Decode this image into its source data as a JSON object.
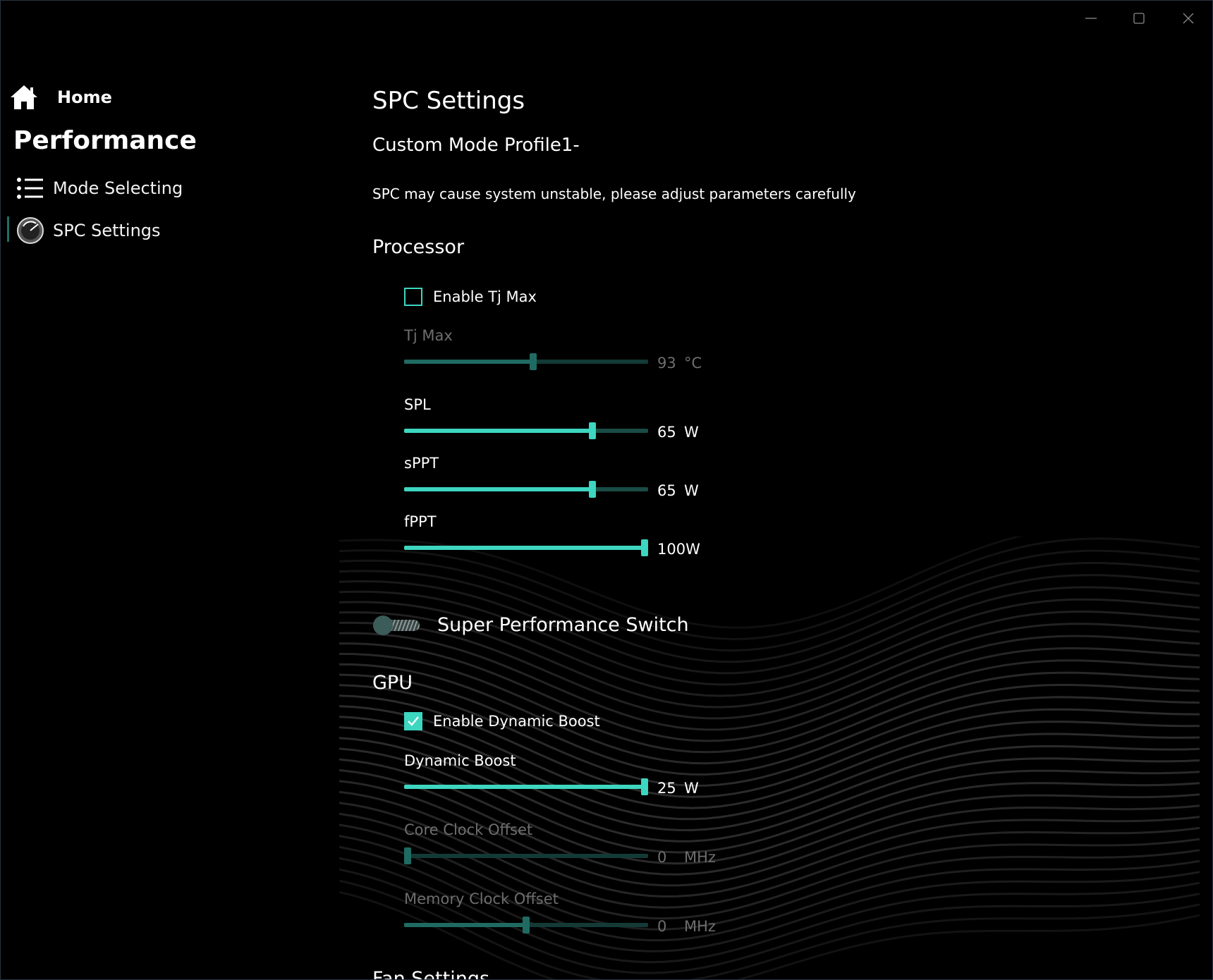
{
  "window": {
    "controls": [
      "minimize",
      "maximize",
      "close"
    ]
  },
  "sidebar": {
    "home_label": "Home",
    "section_title": "Performance",
    "items": [
      {
        "label": "Mode Selecting",
        "icon": "list-icon"
      },
      {
        "label": "SPC Settings",
        "icon": "gauge-icon",
        "selected": true
      }
    ]
  },
  "main": {
    "title": "SPC Settings",
    "profile": "Custom Mode Profile1-",
    "warning": "SPC may cause system unstable, please adjust parameters carefully",
    "processor": {
      "heading": "Processor",
      "enable_tjmax": {
        "label": "Enable Tj Max",
        "checked": false
      },
      "sliders": [
        {
          "label": "Tj Max",
          "value": "93",
          "unit": "°C",
          "fraction": 0.53,
          "enabled": false
        },
        {
          "label": "SPL",
          "value": "65",
          "unit": "W",
          "fraction": 0.78,
          "enabled": true
        },
        {
          "label": "sPPT",
          "value": "65",
          "unit": "W",
          "fraction": 0.78,
          "enabled": true
        },
        {
          "label": "fPPT",
          "value": "100",
          "unit": "W",
          "fraction": 1.0,
          "enabled": true
        }
      ]
    },
    "super_performance": {
      "label": "Super Performance Switch",
      "on": false
    },
    "gpu": {
      "heading": "GPU",
      "enable_dynamic_boost": {
        "label": "Enable Dynamic Boost",
        "checked": true
      },
      "sliders": [
        {
          "label": "Dynamic Boost",
          "value": "25",
          "unit": "W",
          "fraction": 1.0,
          "enabled": true
        },
        {
          "label": "Core Clock Offset",
          "value": "0",
          "unit": "MHz",
          "fraction": 0.0,
          "enabled": false
        },
        {
          "label": "Memory Clock Offset",
          "value": "0",
          "unit": "MHz",
          "fraction": 0.5,
          "enabled": false
        }
      ]
    },
    "next_heading": "Fan Settings"
  },
  "colors": {
    "accent": "#3dd6c0",
    "accent_dim": "#1f6b62",
    "background": "#000000",
    "disabled_text": "#6e6e6e"
  }
}
